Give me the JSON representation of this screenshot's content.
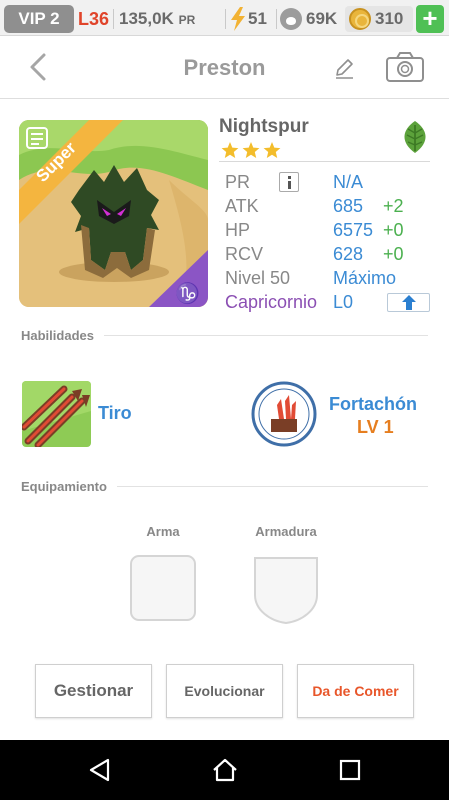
{
  "status_bar": {
    "vip": "VIP 2",
    "level": "L36",
    "food": "135,0K",
    "food_unit": "PR",
    "energy": "51",
    "paw_currency": "69K",
    "coins": "310",
    "plus": "+"
  },
  "header": {
    "title": "Preston",
    "icons": [
      "back-icon",
      "edit-icon",
      "camera-icon"
    ]
  },
  "creature": {
    "badge": "Super",
    "name": "Nightspur",
    "stars": 3,
    "element_icon": "leaf-icon",
    "stats": [
      {
        "label": "PR",
        "value": "N/A",
        "bonus": ""
      },
      {
        "label": "ATK",
        "value": "685",
        "bonus": "+2"
      },
      {
        "label": "HP",
        "value": "6575",
        "bonus": "+0"
      },
      {
        "label": "RCV",
        "value": "628",
        "bonus": "+0"
      },
      {
        "label": "Nivel 50",
        "value": "Máximo",
        "bonus": ""
      },
      {
        "label": "Capricornio",
        "value": "L0",
        "bonus": ""
      }
    ]
  },
  "abilities": {
    "section_title": "Habilidades",
    "primary": {
      "name": "Tiro"
    },
    "secondary": {
      "name": "Fortachón",
      "level": "LV 1"
    }
  },
  "equipment": {
    "section_title": "Equipamiento",
    "weapon_label": "Arma",
    "armor_label": "Armadura"
  },
  "actions": {
    "manage": "Gestionar",
    "evolve": "Evolucionar",
    "feed": "Da de Comer"
  },
  "colors": {
    "accent_blue": "#3b8bd4",
    "bonus_green": "#4bb04f",
    "level_red": "#e0442a",
    "feed_orange": "#e8562a",
    "zodiac_purple": "#8b4fb3"
  }
}
